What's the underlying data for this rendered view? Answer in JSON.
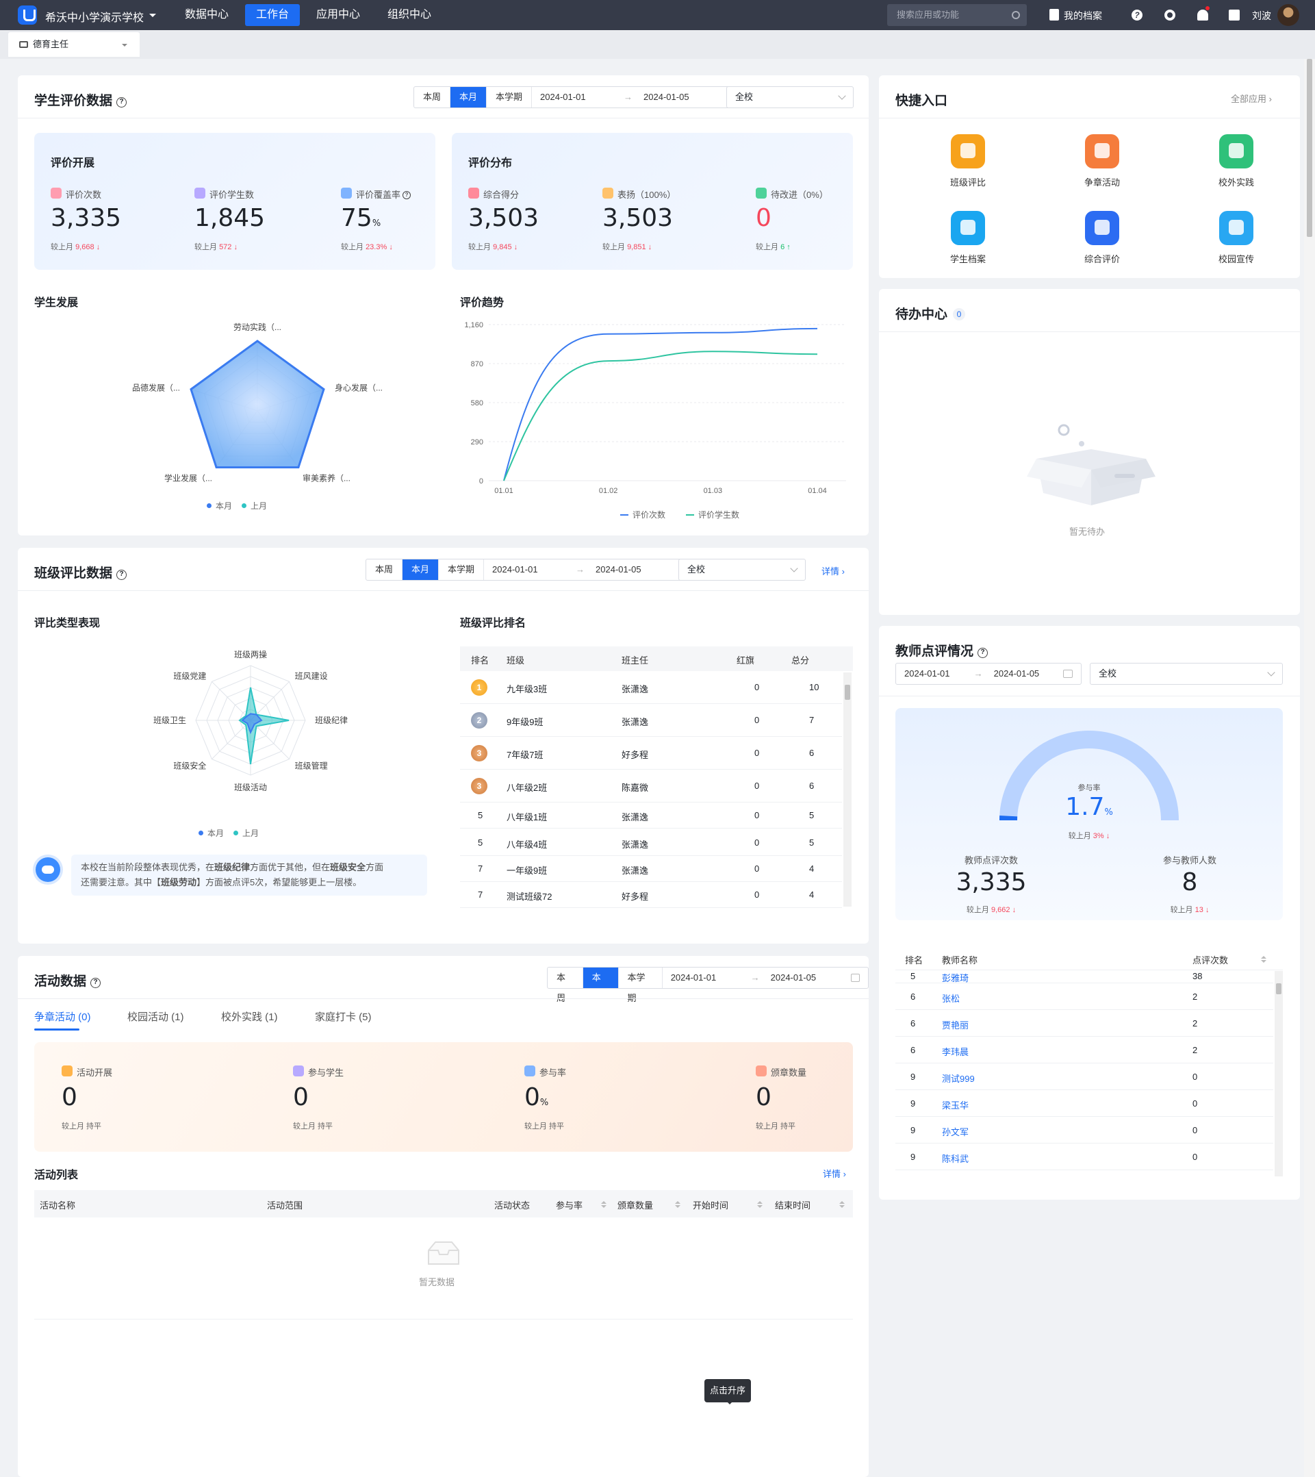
{
  "topbar": {
    "school": "希沃中小学演示学校",
    "nav": [
      "数据中心",
      "工作台",
      "应用中心",
      "组织中心"
    ],
    "active": "工作台",
    "search_placeholder": "搜索应用或功能",
    "profile": "我的档案",
    "user": "刘波"
  },
  "role": "德育主任",
  "filters": {
    "week": "本周",
    "month": "本月",
    "term": "本学期",
    "start": "2024-01-01",
    "end": "2024-01-05",
    "scope": "全校",
    "detail": "详情"
  },
  "student_eval": {
    "title": "学生评价数据",
    "conduct": {
      "title": "评价开展",
      "metrics": [
        {
          "label": "评价次数",
          "value": "3,335",
          "cmp_prefix": "较上月",
          "cmp": "9,668",
          "trend": "down"
        },
        {
          "label": "评价学生数",
          "value": "1,845",
          "cmp_prefix": "较上月",
          "cmp": "572",
          "trend": "down"
        },
        {
          "label": "评价覆盖率",
          "value": "75",
          "unit": "%",
          "cmp_prefix": "较上月",
          "cmp": "23.3%",
          "trend": "down"
        }
      ]
    },
    "distribution": {
      "title": "评价分布",
      "metrics": [
        {
          "label": "综合得分",
          "value": "3,503",
          "cmp_prefix": "较上月",
          "cmp": "9,845",
          "trend": "down"
        },
        {
          "label": "表扬（100%）",
          "value": "3,503",
          "cmp_prefix": "较上月",
          "cmp": "9,851",
          "trend": "down"
        },
        {
          "label": "待改进（0%）",
          "value": "0",
          "cmp_prefix": "较上月",
          "cmp": "6",
          "trend": "up"
        }
      ]
    },
    "development": {
      "title": "学生发展",
      "axes": [
        "劳动实践（...",
        "身心发展（...",
        "审美素养（...",
        "学业发展（...",
        "品德发展（..."
      ],
      "legend": [
        "本月",
        "上月"
      ]
    },
    "trend": {
      "title": "评价趋势"
    }
  },
  "class_eval": {
    "title": "班级评比数据",
    "types": {
      "title": "评比类型表现",
      "axes": [
        "班级两操",
        "班风建设",
        "班级纪律",
        "班级管理",
        "班级活动",
        "班级安全",
        "班级卫生",
        "班级党建"
      ],
      "legend": [
        "本月",
        "上月"
      ]
    },
    "tip": {
      "p1": "本校在当前阶段整体表现优秀，在",
      "b1": "班级纪律",
      "p2": "方面优于其他，但在",
      "b2": "班级安全",
      "p3": "方面",
      "p4": "还需要注意。其中【",
      "b3": "班级劳动",
      "p5": "】方面被点评5次，希望能够更上一层楼。"
    },
    "ranking": {
      "title": "班级评比排名",
      "columns": [
        "排名",
        "班级",
        "班主任",
        "红旗",
        "总分"
      ],
      "rows": [
        {
          "rank": "1",
          "cls": "九年级3班",
          "teacher": "张潇逸",
          "flag": "0",
          "score": "10"
        },
        {
          "rank": "2",
          "cls": "9年级9班",
          "teacher": "张潇逸",
          "flag": "0",
          "score": "7"
        },
        {
          "rank": "3",
          "cls": "7年级7班",
          "teacher": "好多程",
          "flag": "0",
          "score": "6"
        },
        {
          "rank": "3",
          "cls": "八年级2班",
          "teacher": "陈嘉微",
          "flag": "0",
          "score": "6"
        },
        {
          "rank": "5",
          "cls": "八年级1班",
          "teacher": "张潇逸",
          "flag": "0",
          "score": "5"
        },
        {
          "rank": "5",
          "cls": "八年级4班",
          "teacher": "张潇逸",
          "flag": "0",
          "score": "5"
        },
        {
          "rank": "7",
          "cls": "一年级9班",
          "teacher": "张潇逸",
          "flag": "0",
          "score": "4"
        },
        {
          "rank": "7",
          "cls": "测试班级72",
          "teacher": "好多程",
          "flag": "0",
          "score": "4"
        }
      ]
    }
  },
  "activity": {
    "title": "活动数据",
    "tabs": [
      "争章活动 (0)",
      "校园活动 (1)",
      "校外实践 (1)",
      "家庭打卡 (5)"
    ],
    "metrics": [
      {
        "label": "活动开展",
        "value": "0",
        "cmp": "较上月 持平"
      },
      {
        "label": "参与学生",
        "value": "0",
        "cmp": "较上月 持平"
      },
      {
        "label": "参与率",
        "value": "0",
        "unit": "%",
        "cmp": "较上月 持平"
      },
      {
        "label": "颁章数量",
        "value": "0",
        "cmp": "较上月 持平"
      }
    ],
    "list_title": "活动列表",
    "columns": [
      "活动名称",
      "活动范围",
      "活动状态",
      "参与率",
      "颁章数量",
      "开始时间",
      "结束时间"
    ],
    "empty": "暂无数据",
    "tooltip": "点击升序"
  },
  "quick": {
    "title": "快捷入口",
    "all": "全部应用",
    "items": [
      {
        "label": "班级评比",
        "color": "#f7a21c",
        "icon": "badge-icon"
      },
      {
        "label": "争章活动",
        "color": "#f57c3c",
        "icon": "medal-icon"
      },
      {
        "label": "校外实践",
        "color": "#2fc17a",
        "icon": "clover-icon"
      },
      {
        "label": "学生档案",
        "color": "#1aa6f0",
        "icon": "profile-icon"
      },
      {
        "label": "综合评价",
        "color": "#2c6cf2",
        "icon": "eval-icon"
      },
      {
        "label": "校园宣传",
        "color": "#28a7f2",
        "icon": "news-icon"
      }
    ]
  },
  "todo": {
    "title": "待办中心",
    "count": "0",
    "empty": "暂无待办"
  },
  "teacher": {
    "title": "教师点评情况",
    "rate_label": "参与率",
    "rate": "1.7",
    "rate_unit": "%",
    "rate_cmp_prefix": "较上月",
    "rate_cmp": "3%",
    "left_label": "教师点评次数",
    "left_value": "3,335",
    "left_cmp_prefix": "较上月",
    "left_cmp": "9,662",
    "right_label": "参与教师人数",
    "right_value": "8",
    "right_cmp_prefix": "较上月",
    "right_cmp": "13",
    "columns": [
      "排名",
      "教师名称",
      "点评次数"
    ],
    "rows": [
      {
        "rank": "5",
        "name": "彭雅琦",
        "count": "38"
      },
      {
        "rank": "6",
        "name": "张松",
        "count": "2"
      },
      {
        "rank": "6",
        "name": "贾艳丽",
        "count": "2"
      },
      {
        "rank": "6",
        "name": "李玮晨",
        "count": "2"
      },
      {
        "rank": "9",
        "name": "测试999",
        "count": "0"
      },
      {
        "rank": "9",
        "name": "梁玉华",
        "count": "0"
      },
      {
        "rank": "9",
        "name": "孙文军",
        "count": "0"
      },
      {
        "rank": "9",
        "name": "陈科武",
        "count": "0"
      }
    ]
  },
  "chart_data": [
    {
      "type": "line",
      "title": "评价趋势",
      "x": [
        "01.01",
        "01.02",
        "01.03",
        "01.04"
      ],
      "ylim": [
        0,
        1160
      ],
      "yticks": [
        0,
        290,
        580,
        870,
        1160
      ],
      "ytick_labels": [
        "0",
        "290",
        "580",
        "870",
        "1,160"
      ],
      "series": [
        {
          "name": "评价次数",
          "color": "#3a7bf0",
          "values": [
            0,
            1090,
            1100,
            1130
          ]
        },
        {
          "name": "评价学生数",
          "color": "#2ec4a0",
          "values": [
            0,
            890,
            960,
            940
          ]
        }
      ]
    },
    {
      "type": "radar",
      "title": "学生发展",
      "categories": [
        "劳动实践（...",
        "身心发展（...",
        "审美素养（...",
        "学业发展（...",
        "品德发展（..."
      ],
      "max": 100,
      "series": [
        {
          "name": "本月",
          "color": "#3a7bf0",
          "values": [
            100,
            100,
            100,
            100,
            100
          ]
        },
        {
          "name": "上月",
          "color": "#2ec4c4",
          "values": [
            0,
            0,
            0,
            0,
            0
          ]
        }
      ]
    },
    {
      "type": "radar",
      "title": "评比类型表现",
      "categories": [
        "班级两操",
        "班风建设",
        "班级纪律",
        "班级管理",
        "班级活动",
        "班级安全",
        "班级卫生",
        "班级党建"
      ],
      "max": 100,
      "series": [
        {
          "name": "本月",
          "color": "#3a7bf0",
          "values": [
            12,
            15,
            20,
            10,
            22,
            8,
            15,
            10
          ]
        },
        {
          "name": "上月",
          "color": "#2ec4c4",
          "values": [
            60,
            15,
            70,
            15,
            80,
            12,
            20,
            12
          ]
        }
      ]
    },
    {
      "type": "gauge",
      "title": "参与率",
      "value": 1.7,
      "max": 100
    }
  ]
}
